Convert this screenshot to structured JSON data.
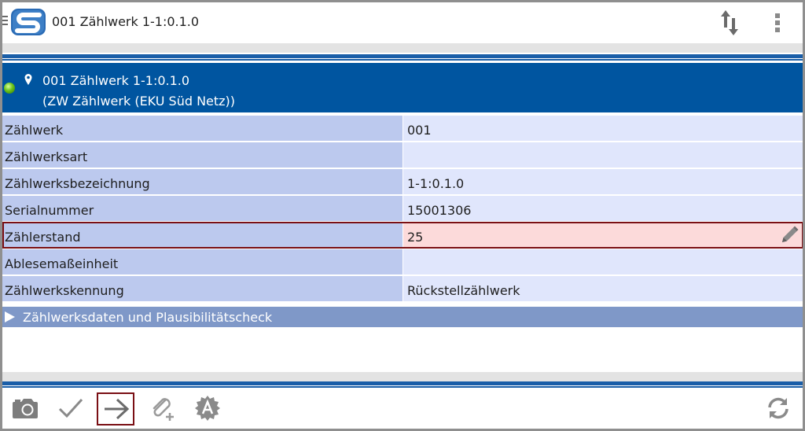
{
  "app": {
    "title": "001 Zählwerk 1-1:0.1.0"
  },
  "header": {
    "title": "001 Zählwerk 1-1:0.1.0",
    "subtitle": "(ZW Zählwerk (EKU Süd Netz))",
    "status_color": "#6cc21a"
  },
  "fields": [
    {
      "label": "Zählwerk",
      "value": "001"
    },
    {
      "label": "Zählwerksart",
      "value": ""
    },
    {
      "label": "Zählwerksbezeichnung",
      "value": "1-1:0.1.0"
    },
    {
      "label": "Serialnummer",
      "value": "15001306"
    },
    {
      "label": "Zählerstand",
      "value": "25"
    },
    {
      "label": "Ablesemaßeinheit",
      "value": ""
    },
    {
      "label": "Zählwerkskennung",
      "value": "Rückstellzählwerk"
    }
  ],
  "section": {
    "label": "Zählwerksdaten und Plausibilitätscheck"
  },
  "toolbar": {
    "buttons": [
      "camera-icon",
      "checkmark-icon",
      "arrow-right-icon",
      "attachment-add-icon",
      "badge-a-icon",
      "sync-icon"
    ]
  },
  "colors": {
    "accent": "#0055a0",
    "label_bg": "#bcc9ee",
    "value_bg": "#e0e6fc",
    "active_bg": "#fcdada",
    "active_border": "#7a0f14"
  }
}
